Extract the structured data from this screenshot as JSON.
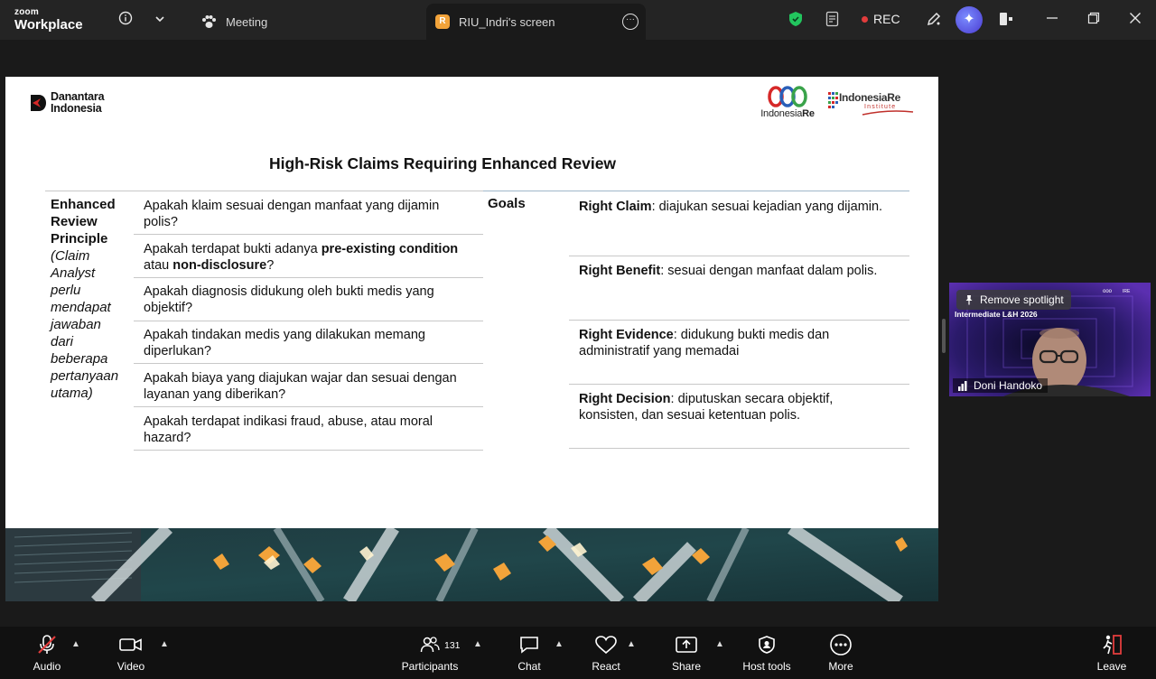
{
  "app": {
    "logo_small": "zoom",
    "logo_big": "Workplace"
  },
  "header": {
    "meeting_tab": "Meeting",
    "screen_tab": "RIU_Indri's screen",
    "screen_badge": "R",
    "rec_label": "REC",
    "icons": [
      "info-icon",
      "chevron-down-icon",
      "meeting-paw-icon",
      "more-icon",
      "shield-icon",
      "notes-icon",
      "annotate-icon",
      "ai-companion-icon",
      "side-panel-icon",
      "minimize-icon",
      "restore-icon",
      "close-icon"
    ]
  },
  "slide": {
    "brand_left": [
      "Danantara",
      "Indonesia"
    ],
    "brand_center": {
      "prefix": "Indonesia",
      "suffix": "Re"
    },
    "brand_right": {
      "title": "IndonesiaRe",
      "sub": "Institute"
    },
    "title": "High-Risk Claims Requiring Enhanced Review",
    "principle_bold": [
      "Enhanced",
      "Review",
      "Principle"
    ],
    "principle_italic": [
      "(Claim",
      "Analyst",
      "perlu",
      "mendapat",
      "jawaban",
      "dari",
      "beberapa",
      "pertanyaan",
      "utama)"
    ],
    "questions": [
      {
        "l1": "Apakah klaim sesuai dengan manfaat yang dijamin",
        "l2": "polis?"
      },
      {
        "l1_pre": "Apakah terdapat bukti adanya ",
        "l1_bold": "pre-existing condition",
        "l2_pre": "atau ",
        "l2_bold": "non-disclosure",
        "l2_post": "?"
      },
      {
        "l1": "Apakah diagnosis didukung oleh bukti medis yang",
        "l2": "objektif?"
      },
      {
        "l1": "Apakah tindakan medis yang dilakukan memang",
        "l2": "diperlukan?"
      },
      {
        "l1": "Apakah biaya yang diajukan wajar dan sesuai dengan",
        "l2": "layanan yang diberikan?"
      },
      {
        "l1": "Apakah terdapat indikasi fraud, abuse, atau moral",
        "l2": "hazard?"
      }
    ],
    "goals_label": "Goals",
    "goals": [
      {
        "bold": "Right Claim",
        "l1": ": diajukan sesuai kejadian yang dijamin.",
        "l2": ""
      },
      {
        "bold": "Right Benefit",
        "l1": ": sesuai dengan manfaat dalam polis.",
        "l2": ""
      },
      {
        "bold": "Right Evidence",
        "l1": ": didukung bukti medis dan",
        "l2": "administratif yang memadai"
      },
      {
        "bold": "Right Decision",
        "l1": ": diputuskan secara objektif,",
        "l2": "konsisten, dan sesuai ketentuan polis."
      }
    ]
  },
  "video": {
    "spotlight_label": "Remove spotlight",
    "banner_text": "Intermediate L&H 2026",
    "participant_name": "Doni Handoko"
  },
  "toolbar": {
    "audio": "Audio",
    "video": "Video",
    "participants": "Participants",
    "participants_count": "131",
    "chat": "Chat",
    "react": "React",
    "share": "Share",
    "host_tools": "Host tools",
    "more": "More",
    "leave": "Leave"
  },
  "colors": {
    "topbar": "#242424",
    "background": "#1a1a1a",
    "toolbar": "#111111",
    "rec_dot": "#e23c3c",
    "badge": "#f2a33a",
    "shield": "#22c55e",
    "mute_red": "#e23c3c"
  }
}
